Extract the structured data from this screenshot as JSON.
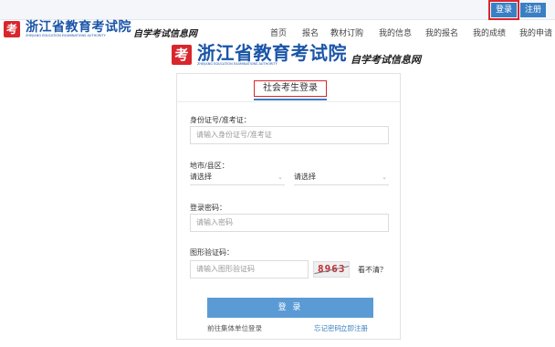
{
  "topbar": {
    "login_label": "登录",
    "register_label": "注册"
  },
  "brand": {
    "emblem_char": "考",
    "title": "浙江省教育考试院",
    "subtitle_en": "ZHEJIANG EDUCATION EXAMINATIONS AUTHORITY",
    "slogan": "自学考试信息网"
  },
  "nav": {
    "items": [
      "首页",
      "报名",
      "教材订购",
      "我的信息",
      "我的报名",
      "我的成绩",
      "我的申请"
    ]
  },
  "login": {
    "tab_label": "社会考生登录",
    "id_label": "身份证号/准考证：",
    "id_placeholder": "请输入身份证号/准考证",
    "region_label": "地市/县区：",
    "city_value": "请选择",
    "district_value": "请选择",
    "password_label": "登录密码：",
    "password_placeholder": "请输入密码",
    "captcha_label": "图形验证码：",
    "captcha_placeholder": "请输入图形验证码",
    "captcha_text": "8963",
    "captcha_refresh": "看不清？",
    "submit_label": "登 录",
    "group_login_link": "前往集体单位登录",
    "forgot_link": "忘记密码",
    "register_link": "立即注册"
  },
  "colors": {
    "accent": "#3a7fc3",
    "brand_red": "#d9262d",
    "brand_blue": "#1a55a8"
  },
  "icons": {
    "select_caret": "chevron-down-icon"
  }
}
